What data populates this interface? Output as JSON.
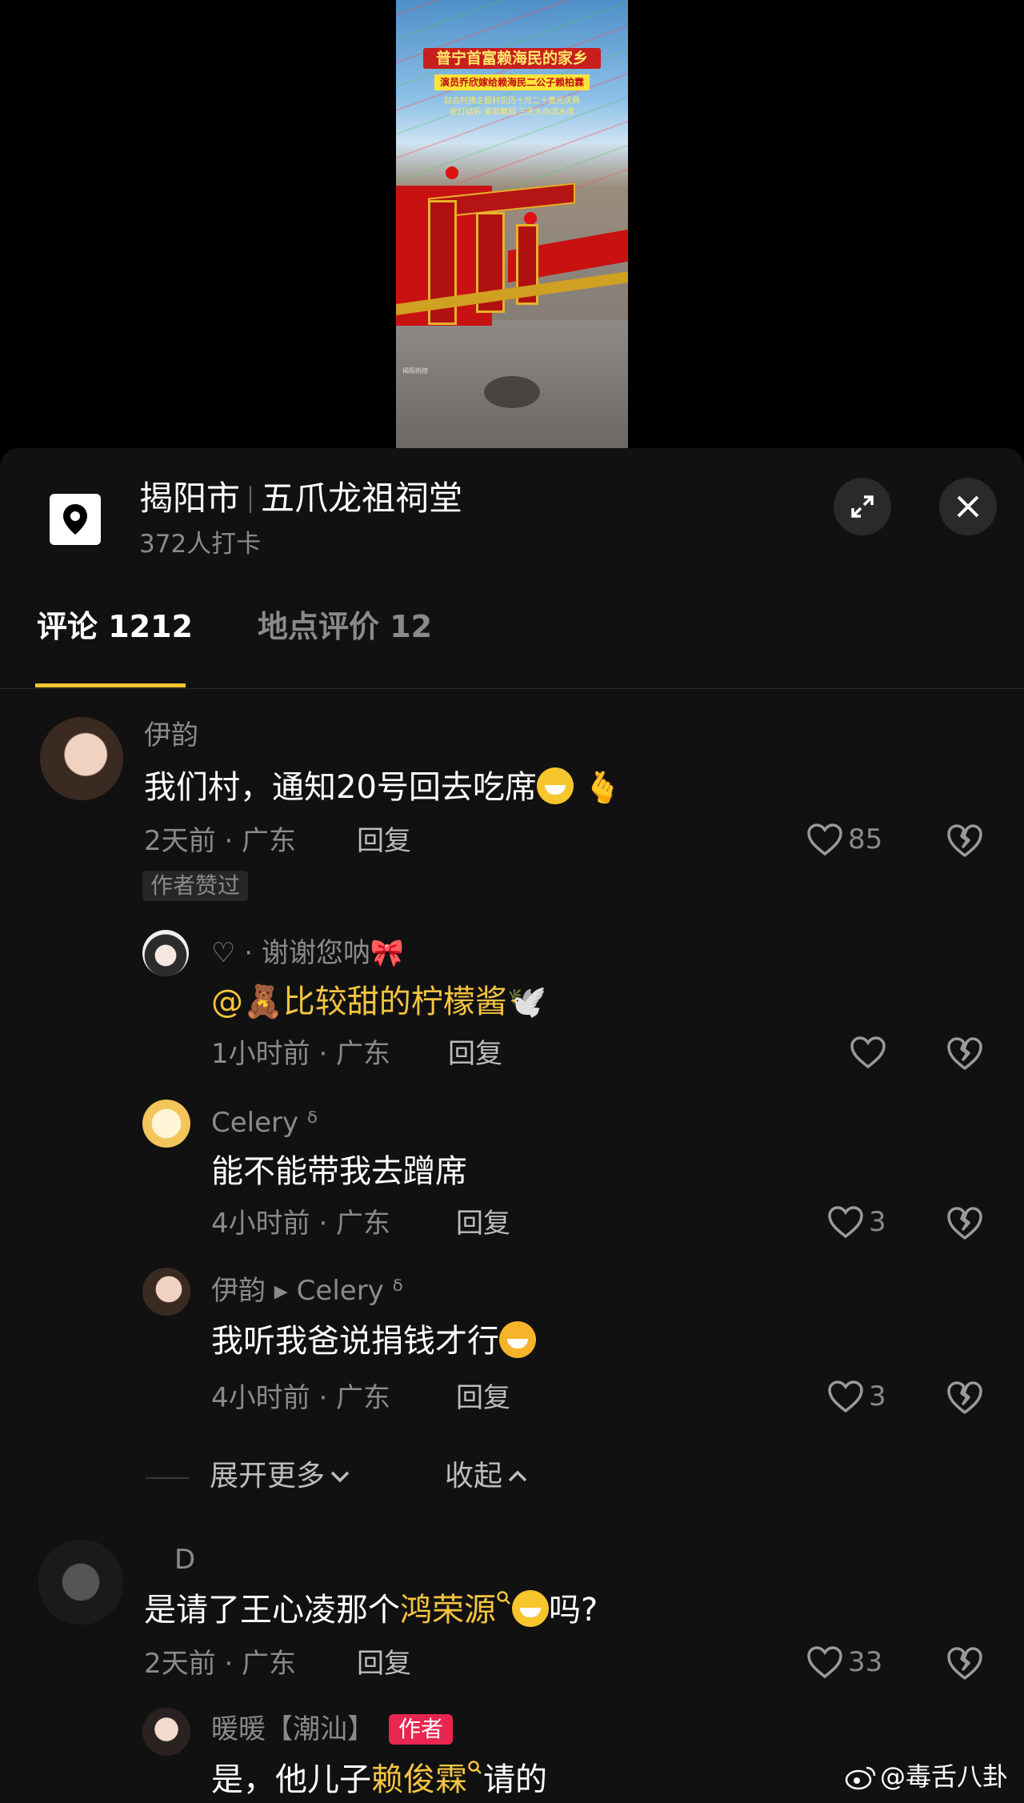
{
  "video": {
    "title_line1": "普宁首富赖海民的家乡",
    "title_line2": "演员乔欣嫁给赖海民二公子赖柏霖",
    "title_line3": "赵古村摘主题村农历十月二十重光庆典",
    "title_line4": "张灯结彩 美歌舞蹈 三天大办流水席",
    "watermark": "揭阳热榜"
  },
  "location": {
    "city": "揭阳市",
    "place": "五爪龙祖祠堂",
    "checkins": "372人打卡"
  },
  "tabs": [
    {
      "label": "评论 1212",
      "active": true
    },
    {
      "label": "地点评价 12",
      "active": false
    }
  ],
  "comments": [
    {
      "user": "伊韵",
      "text": "我们村，通知20号回去吃席",
      "time_location": "2天前 · 广东",
      "reply_label": "回复",
      "likes": "85",
      "badge": "作者赞过",
      "replies": [
        {
          "user": "♡ · 谢谢您呐🎀",
          "mention": "@🧸比较甜的柠檬酱🕊️",
          "time_location": "1小时前 · 广东",
          "reply_label": "回复",
          "likes": ""
        },
        {
          "user": "Celery ᵟ",
          "text": "能不能带我去蹭席",
          "time_location": "4小时前 · 广东",
          "reply_label": "回复",
          "likes": "3"
        },
        {
          "user": "伊韵 ▸ Celery ᵟ",
          "text": "我听我爸说捐钱才行",
          "time_location": "4小时前 · 广东",
          "reply_label": "回复",
          "likes": "3"
        }
      ],
      "expand_label": "展开更多",
      "collapse_label": "收起"
    },
    {
      "user": "D",
      "text_before": "是请了王心凌那个",
      "text_highlight": "鸿荣源",
      "text_after": "吗?",
      "time_location": "2天前 · 广东",
      "reply_label": "回复",
      "likes": "33",
      "replies": [
        {
          "user": "暖暖【潮汕】",
          "author_badge": "作者",
          "text_before": "是，他儿子",
          "text_highlight": "赖俊霖",
          "text_after": "请的"
        }
      ]
    }
  ],
  "weibo_watermark": "@毒舌八卦",
  "colors": {
    "background": "#000000",
    "sheet": "#111111",
    "accent": "#f4c430",
    "author_badge": "#e8264f",
    "muted_text": "#8a8a8a"
  },
  "icons": [
    "location-pin-icon",
    "expand-icon",
    "close-icon",
    "heart-icon",
    "broken-heart-icon",
    "chevron-down-icon",
    "chevron-up-icon",
    "search-icon",
    "weibo-icon"
  ]
}
